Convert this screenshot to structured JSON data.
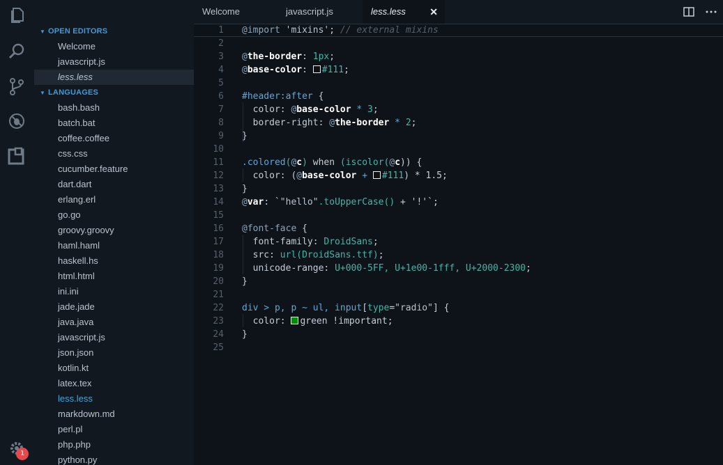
{
  "activity_bar": {
    "icons": [
      "explorer-icon",
      "search-icon",
      "source-control-icon",
      "debug-icon",
      "extensions-icon",
      "settings-gear-icon"
    ],
    "badge": "1"
  },
  "sidebar": {
    "open_editors_header": "OPEN EDITORS",
    "open_editors": [
      "Welcome",
      "javascript.js",
      "less.less"
    ],
    "languages_header": "LANGUAGES",
    "languages": [
      "bash.bash",
      "batch.bat",
      "coffee.coffee",
      "css.css",
      "cucumber.feature",
      "dart.dart",
      "erlang.erl",
      "go.go",
      "groovy.groovy",
      "haml.haml",
      "haskell.hs",
      "html.html",
      "ini.ini",
      "jade.jade",
      "java.java",
      "javascript.js",
      "json.json",
      "kotlin.kt",
      "latex.tex",
      "less.less",
      "markdown.md",
      "perl.pl",
      "php.php",
      "python.py"
    ]
  },
  "tabs": {
    "items": [
      "Welcome",
      "javascript.js",
      "less.less"
    ],
    "close": "✕"
  },
  "editor": {
    "line_numbers": [
      "1",
      "2",
      "3",
      "4",
      "5",
      "6",
      "7",
      "8",
      "9",
      "10",
      "11",
      "12",
      "13",
      "14",
      "15",
      "16",
      "17",
      "18",
      "19",
      "20",
      "21",
      "22",
      "23",
      "24",
      "25"
    ],
    "code": {
      "l1_import": "@import",
      "l1_str": "'mixins'",
      "l1_semi": ";",
      "l1_comment": "// external mixins",
      "l3_at": "@",
      "l3_var": "the-border",
      "l3_colon": ":",
      "l3_val": "1px",
      "l3_semi": ";",
      "l4_at": "@",
      "l4_var": "base-color",
      "l4_colon": ":",
      "l4_val": "#111",
      "l4_semi": ";",
      "l6_sel": "#header",
      "l6_pseudo": ":after",
      "l6_brace": " {",
      "l7_prop": "color",
      "l7_colon": ": ",
      "l7_at": "@",
      "l7_var": "base-color",
      "l7_op": " * ",
      "l7_num": "3",
      "l7_semi": ";",
      "l8_prop": "border-right",
      "l8_colon": ": ",
      "l8_at": "@",
      "l8_var": "the-border",
      "l8_op": " * ",
      "l8_num": "2",
      "l8_semi": ";",
      "l9": "}",
      "l11_sel": ".colored",
      "l11_p1": "(",
      "l11_at": "@",
      "l11_var": "c",
      "l11_p2": ") ",
      "l11_when": "when",
      "l11_fn": " (iscolor(",
      "l11_at2": "@",
      "l11_var2": "c",
      "l11_end": ")) {",
      "l12_prop": "color",
      "l12_colon": ": (",
      "l12_at": "@",
      "l12_var": "base-color",
      "l12_op": " + ",
      "l12_val": "#111",
      "l12_rest": ") * 1.5;",
      "l13": "}",
      "l14_at": "@",
      "l14_var": "var",
      "l14_colon": ": `",
      "l14_str": "\"hello\"",
      "l14_fn": ".toUpperCase()",
      "l14_rest": " + '!'`;",
      "l16_at": "@font-face",
      "l16_brace": " {",
      "l17_prop": "font-family",
      "l17_colon": ": ",
      "l17_val": "DroidSans",
      "l17_semi": ";",
      "l18_prop": "src",
      "l18_colon": ": ",
      "l18_url": "url(DroidSans.ttf)",
      "l18_semi": ";",
      "l19_prop": "unicode-range",
      "l19_colon": ": ",
      "l19_val": "U+000-5FF, U+1e00-1fff, U+2000-2300",
      "l19_semi": ";",
      "l20": "}",
      "l22_sel": "div > p, p ~ ul, input",
      "l22_attr1": "[",
      "l22_attrname": "type",
      "l22_eq": "=",
      "l22_attrval": "\"radio\"",
      "l22_attr2": "]",
      "l22_brace": " {",
      "l23_prop": "color",
      "l23_colon": ": ",
      "l23_val": "green !important",
      "l23_semi": ";",
      "l24": "}"
    }
  },
  "colors": {
    "accent": "#3f9ad8",
    "background": "#0e131a",
    "sidebar": "#121820",
    "badge": "#e5484d",
    "green_swatch": "#0a8a0a",
    "dark_swatch": "#111111"
  }
}
